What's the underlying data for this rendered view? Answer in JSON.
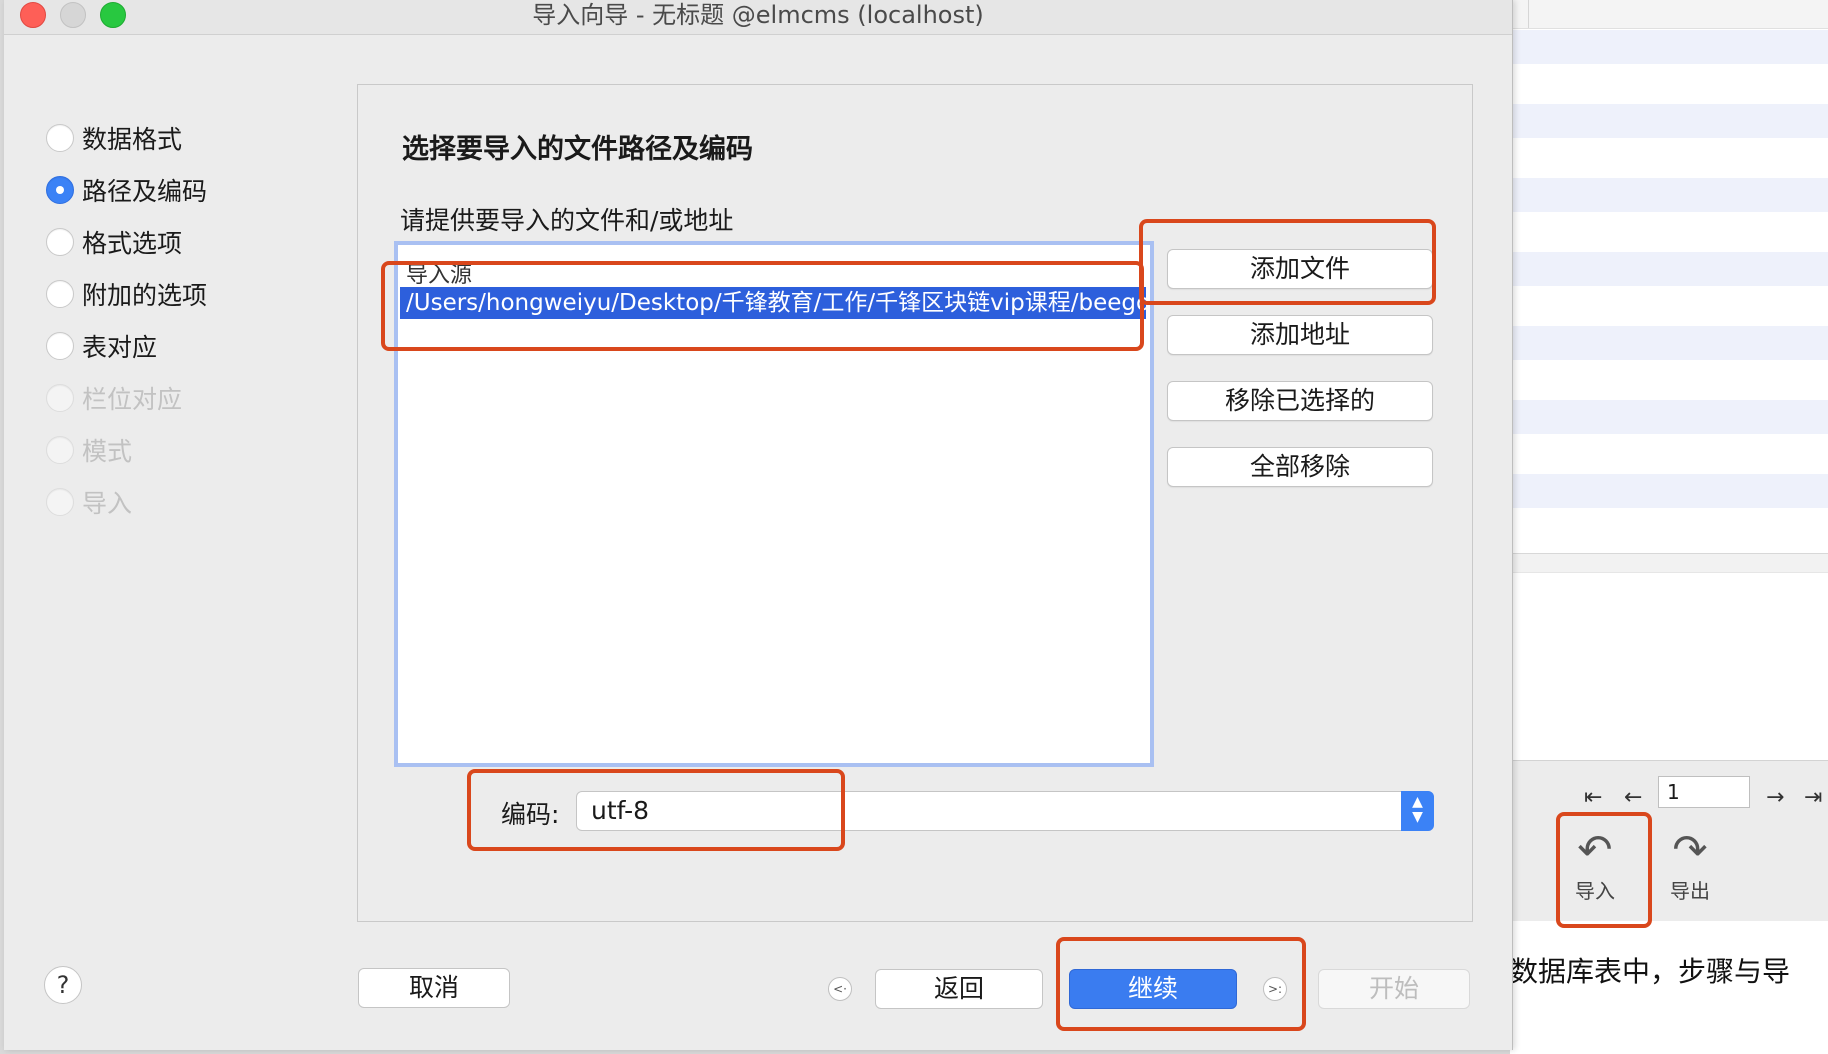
{
  "window": {
    "title": "导入向导 - 无标题 @elmcms (localhost)"
  },
  "steps": [
    {
      "label": "数据格式",
      "state": "normal"
    },
    {
      "label": "路径及编码",
      "state": "active"
    },
    {
      "label": "格式选项",
      "state": "normal"
    },
    {
      "label": "附加的选项",
      "state": "normal"
    },
    {
      "label": "表对应",
      "state": "normal"
    },
    {
      "label": "栏位对应",
      "state": "disabled"
    },
    {
      "label": "模式",
      "state": "disabled"
    },
    {
      "label": "导入",
      "state": "disabled"
    }
  ],
  "panel": {
    "heading": "选择要导入的文件路径及编码",
    "prompt": "请提供要导入的文件和/或地址",
    "list_header": "导入源",
    "selected_source": "/Users/hongweiyu/Desktop/千锋教育/工作/千锋区块链vip课程/beego...",
    "buttons": {
      "add_file": "添加文件",
      "add_address": "添加地址",
      "remove_selected": "移除已选择的",
      "remove_all": "全部移除"
    },
    "encoding_label": "编码:",
    "encoding_value": "utf-8"
  },
  "footer": {
    "help": "?",
    "cancel": "取消",
    "back": "返回",
    "continue": "继续",
    "start": "开始",
    "back_glyph": "<·",
    "forward_glyph": ">:"
  },
  "background_app": {
    "page_number": "1",
    "import_label": "导入",
    "export_label": "导出",
    "trailing_text": "数据库表中，步骤与导"
  },
  "colors": {
    "accent": "#3b82f6",
    "selection": "#2d5fdc",
    "highlight_box": "#d9471c"
  }
}
